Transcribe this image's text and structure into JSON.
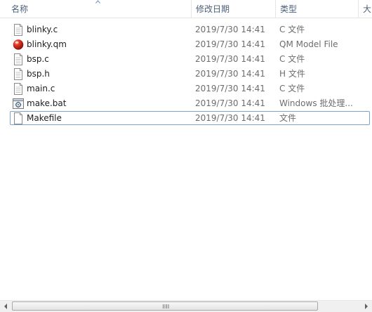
{
  "columns": {
    "name": "名称",
    "modified": "修改日期",
    "type": "类型",
    "size": "大"
  },
  "files": [
    {
      "name": "blinky.c",
      "modified": "2019/7/30 14:41",
      "type": "C 文件",
      "icon": "c-file-icon"
    },
    {
      "name": "blinky.qm",
      "modified": "2019/7/30 14:41",
      "type": "QM Model File",
      "icon": "qm-model-icon"
    },
    {
      "name": "bsp.c",
      "modified": "2019/7/30 14:41",
      "type": "C 文件",
      "icon": "c-file-icon"
    },
    {
      "name": "bsp.h",
      "modified": "2019/7/30 14:41",
      "type": "H 文件",
      "icon": "h-file-icon"
    },
    {
      "name": "main.c",
      "modified": "2019/7/30 14:41",
      "type": "C 文件",
      "icon": "c-file-icon"
    },
    {
      "name": "make.bat",
      "modified": "2019/7/30 14:41",
      "type": "Windows 批处理...",
      "icon": "batch-file-icon"
    },
    {
      "name": "Makefile",
      "modified": "2019/7/30 14:41",
      "type": "文件",
      "icon": "blank-file-icon",
      "selected": true
    }
  ],
  "colors": {
    "header_text": "#4c607a",
    "detail_text": "#6d6d6d",
    "selection_border": "#7da2ce",
    "qm_icon": "#d42a1c"
  }
}
